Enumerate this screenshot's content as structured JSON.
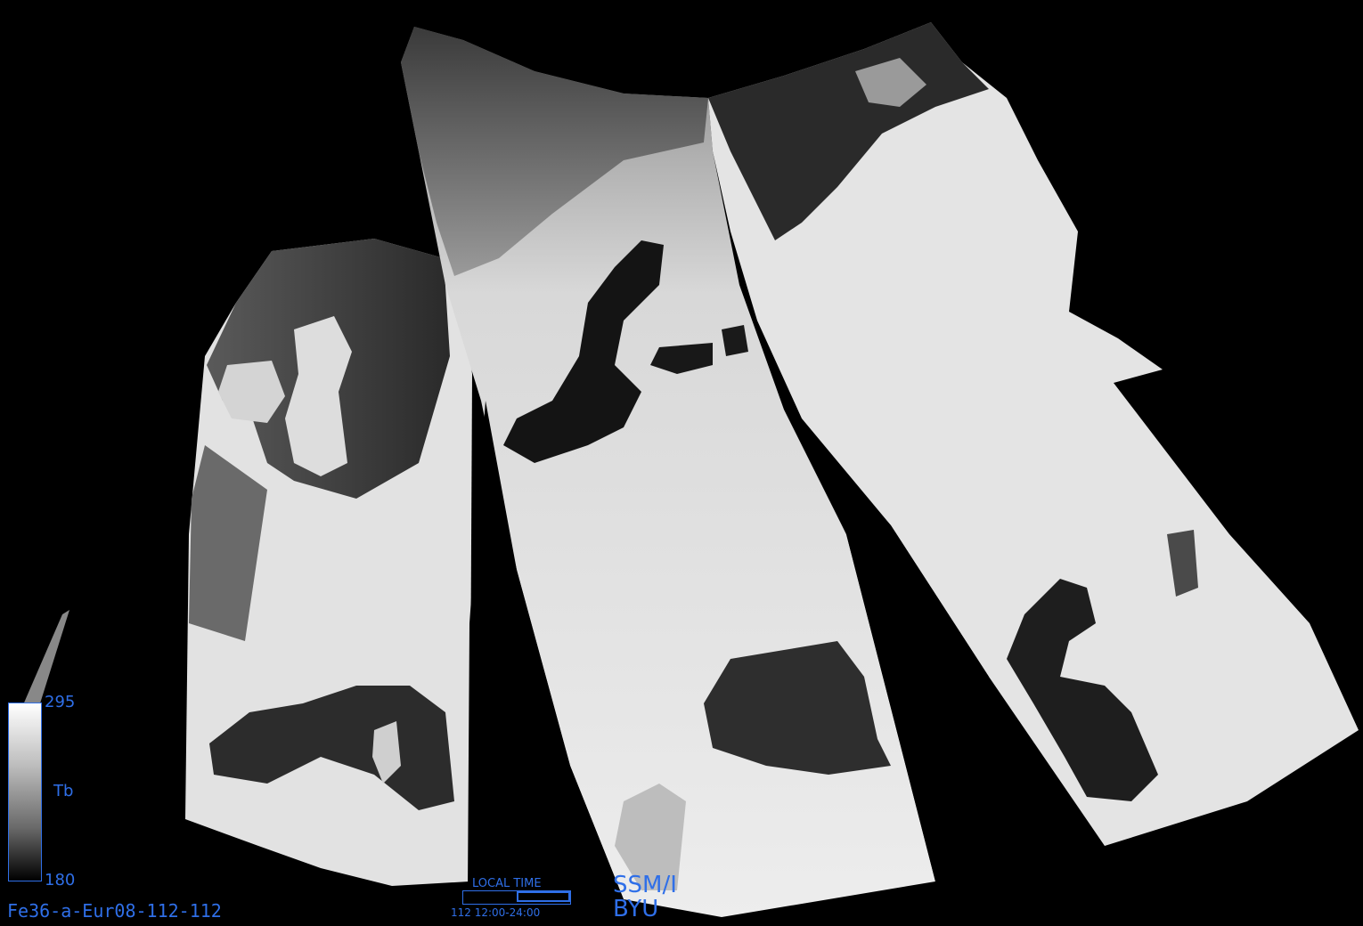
{
  "legend": {
    "max_label": "295",
    "mid_label": "Tb",
    "min_label": "180",
    "gradient_colors": [
      "#ffffff",
      "#000000"
    ]
  },
  "footer": {
    "product_id": "Fe36-a-Eur08-112-112",
    "local_time_title": "LOCAL TIME",
    "local_time_range": "112 12:00-24:00",
    "sensor": "SSM/I",
    "org": "BYU"
  },
  "colors": {
    "text": "#2f6fe8",
    "background": "#000000",
    "land": "#e6e6e6",
    "water": "#202020"
  }
}
